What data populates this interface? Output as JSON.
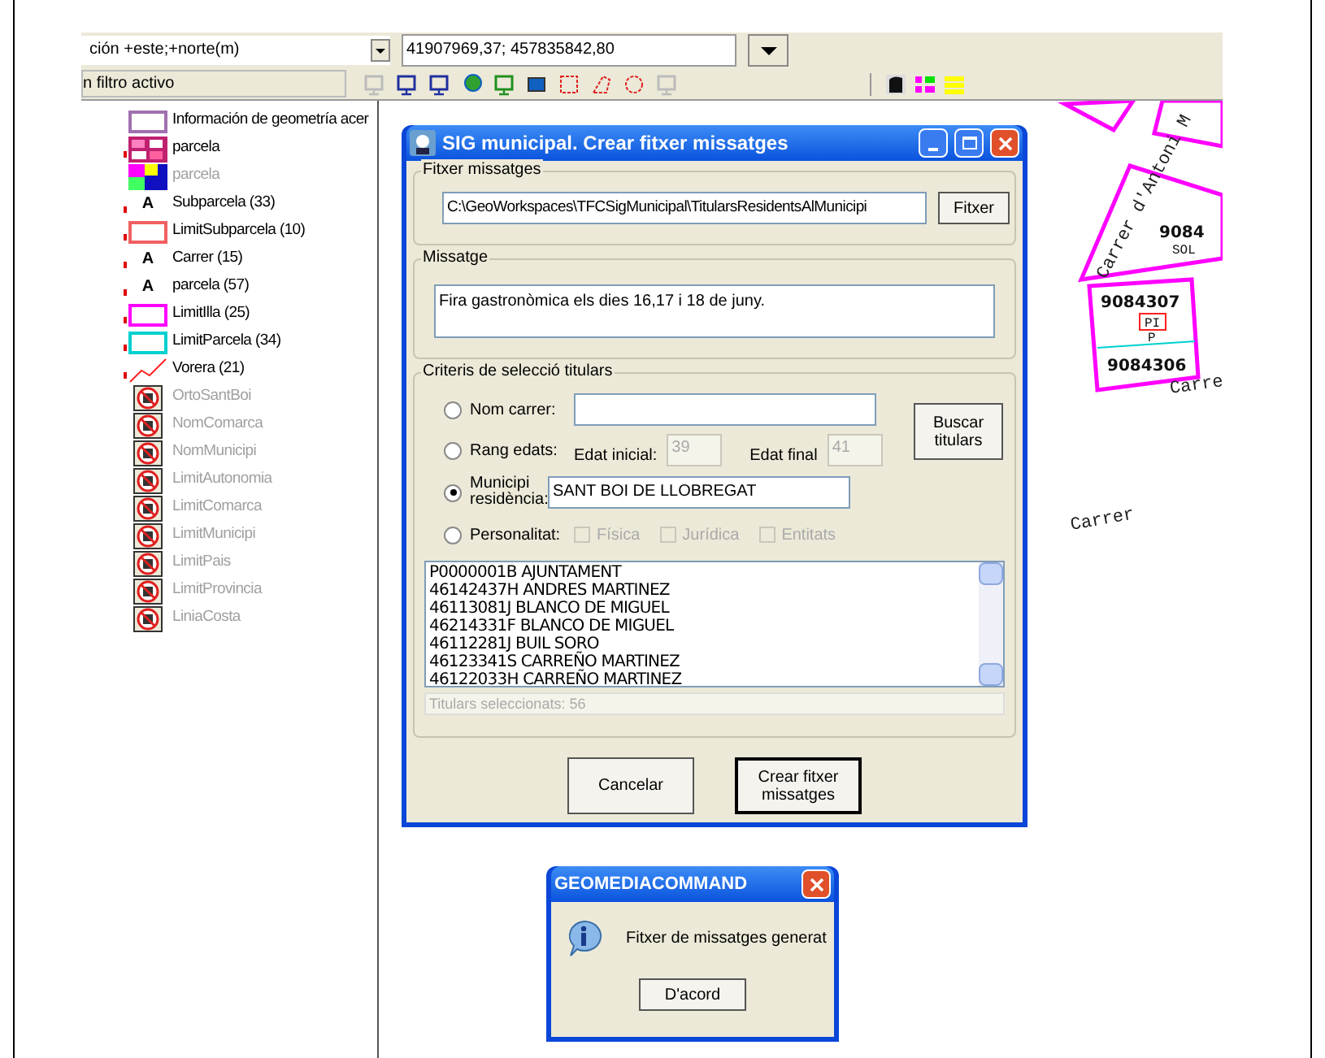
{
  "toolbar": {
    "coordinate_system": "ción +este;+norte(m)",
    "coordinates": "41907969,37; 457835842,80",
    "filter": "n filtro activo"
  },
  "legend": [
    {
      "label": "Información de geometría acer",
      "kind": "box",
      "color": "#a070b0",
      "disabled": false,
      "visible": false
    },
    {
      "label": "parcela",
      "kind": "pattern",
      "disabled": false,
      "visible": true
    },
    {
      "label": "parcela",
      "kind": "fill",
      "disabled": true,
      "visible": false
    },
    {
      "label": "Subparcela (33)",
      "kind": "text",
      "icon_text": "A",
      "disabled": false,
      "visible": true
    },
    {
      "label": "LimitSubparcela (10)",
      "kind": "box",
      "color": "#f06060",
      "disabled": false,
      "visible": true
    },
    {
      "label": "Carrer (15)",
      "kind": "text",
      "icon_text": "A",
      "disabled": false,
      "visible": true
    },
    {
      "label": "parcela (57)",
      "kind": "text",
      "icon_text": "A",
      "disabled": false,
      "visible": true
    },
    {
      "label": "LimitIlla (25)",
      "kind": "box",
      "color": "#ff00ff",
      "disabled": false,
      "visible": true
    },
    {
      "label": "LimitParcela (34)",
      "kind": "box",
      "color": "#00d0d0",
      "disabled": false,
      "visible": true
    },
    {
      "label": "Vorera (21)",
      "kind": "line",
      "disabled": false,
      "visible": true
    },
    {
      "label": "OrtoSantBoi",
      "kind": "blocked",
      "disabled": true,
      "visible": false
    },
    {
      "label": "NomComarca",
      "kind": "blocked",
      "disabled": true,
      "visible": false
    },
    {
      "label": "NomMunicipi",
      "kind": "blocked",
      "disabled": true,
      "visible": false
    },
    {
      "label": "LimitAutonomia",
      "kind": "blocked",
      "disabled": true,
      "visible": false
    },
    {
      "label": "LimitComarca",
      "kind": "blocked",
      "disabled": true,
      "visible": false
    },
    {
      "label": "LimitMunicipi",
      "kind": "blocked",
      "disabled": true,
      "visible": false
    },
    {
      "label": "LimitPais",
      "kind": "blocked",
      "disabled": true,
      "visible": false
    },
    {
      "label": "LimitProvincia",
      "kind": "blocked",
      "disabled": true,
      "visible": false
    },
    {
      "label": "LiniaCosta",
      "kind": "blocked",
      "disabled": true,
      "visible": false
    }
  ],
  "map": {
    "labels": [
      {
        "text": "Carrer d'Antoni M",
        "kind": "street"
      },
      {
        "text": "9084",
        "kind": "parcel"
      },
      {
        "text": "SOL",
        "kind": "small"
      },
      {
        "text": "9084307",
        "kind": "parcel"
      },
      {
        "text": "PI",
        "kind": "small"
      },
      {
        "text": "P",
        "kind": "small"
      },
      {
        "text": "9084306",
        "kind": "parcel"
      },
      {
        "text": "Carre",
        "kind": "street"
      },
      {
        "text": "Carrer",
        "kind": "street"
      }
    ]
  },
  "dialog": {
    "title": "SIG municipal. Crear fitxer missatges",
    "file_group": {
      "label": "Fitxer missatges",
      "path": "C:\\GeoWorkspaces\\TFCSigMunicipal\\TitularsResidentsAlMunicipi",
      "button": "Fitxer"
    },
    "message_group": {
      "label": "Missatge",
      "text": "Fira gastronòmica els dies 16,17 i 18 de juny."
    },
    "criteria_group": {
      "label": "Criteris de selecció titulars",
      "street": {
        "label": "Nom carrer:",
        "selected": false
      },
      "ages": {
        "label": "Rang edats:",
        "selected": false,
        "from_label": "Edat inicial:",
        "from": "39",
        "to_label": "Edat final",
        "to": "41",
        "disabled": true
      },
      "municipality": {
        "label": "Municipi residència:",
        "selected": true,
        "value": "SANT BOI DE LLOBREGAT"
      },
      "personality": {
        "label": "Personalitat:",
        "selected": false,
        "options": [
          {
            "label": "Física",
            "checked": false,
            "disabled": true
          },
          {
            "label": "Jurídica",
            "checked": false,
            "disabled": true
          },
          {
            "label": "Entitats",
            "checked": false,
            "disabled": true
          }
        ]
      },
      "search_button": "Buscar titulars",
      "results": [
        "P0000001B AJUNTAMENT",
        "46142437H ANDRES MARTINEZ",
        "46113081J BLANCO DE MIGUEL",
        "46214331F BLANCO DE MIGUEL",
        "46112281J BUIL SORO",
        "46123341S CARREÑO MARTINEZ",
        "46122033H CARREÑO MARTINEZ"
      ],
      "count": "Titulars seleccionats: 56"
    },
    "buttons": [
      {
        "label": "Cancelar",
        "default": false
      },
      {
        "label": "Crear fitxer missatges",
        "default": true
      }
    ]
  },
  "message_box": {
    "title": "GEOMEDIACOMMAND",
    "text": "Fitxer de missatges generat",
    "button": "D'acord"
  }
}
